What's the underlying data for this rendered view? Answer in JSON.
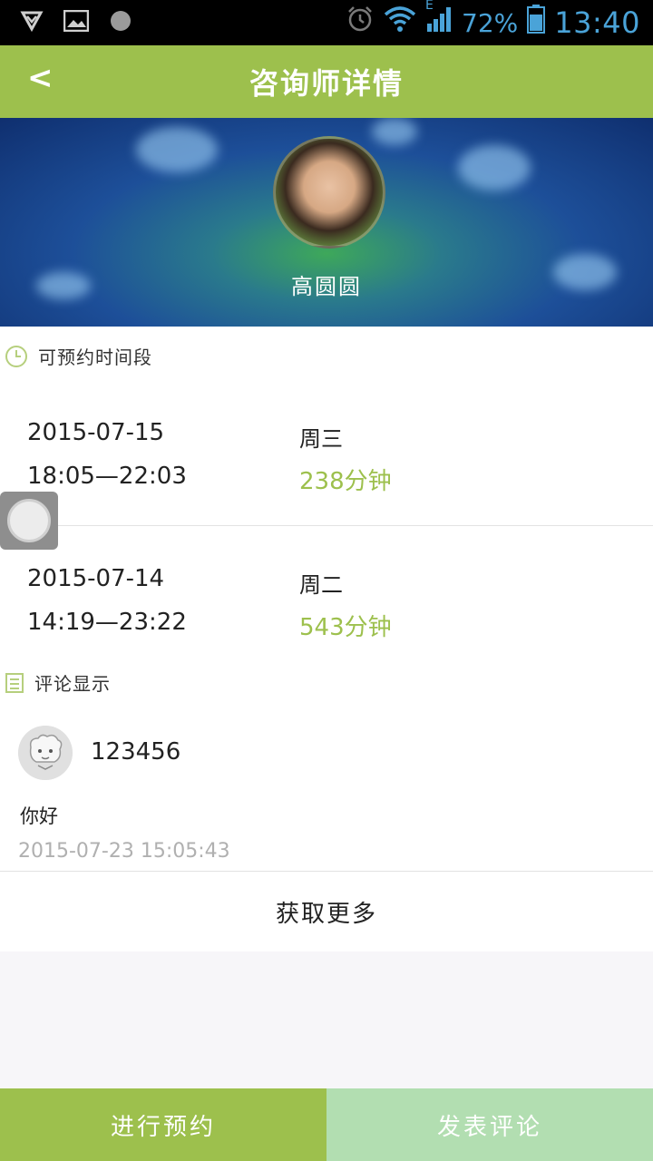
{
  "statusbar": {
    "battery_pct": "72%",
    "time": "13:40",
    "network": "E"
  },
  "header": {
    "back_label": "<",
    "title": "咨询师详情"
  },
  "profile": {
    "name": "高圆圆"
  },
  "slots_section": {
    "heading": "可预约时间段",
    "items": [
      {
        "date": "2015-07-15",
        "weekday": "周三",
        "time_range": "18:05—22:03",
        "duration": "238分钟"
      },
      {
        "date": "2015-07-14",
        "weekday": "周二",
        "time_range": "14:19—23:22",
        "duration": "543分钟"
      }
    ]
  },
  "comments_section": {
    "heading": "评论显示",
    "items": [
      {
        "user": "123456",
        "text": "你好",
        "timestamp": "2015-07-23 15:05:43"
      }
    ],
    "more_label": "获取更多"
  },
  "bottom_bar": {
    "book_label": "进行预约",
    "comment_label": "发表评论"
  },
  "colors": {
    "accent": "#9dc04d",
    "accent_light": "#b2deb1"
  }
}
